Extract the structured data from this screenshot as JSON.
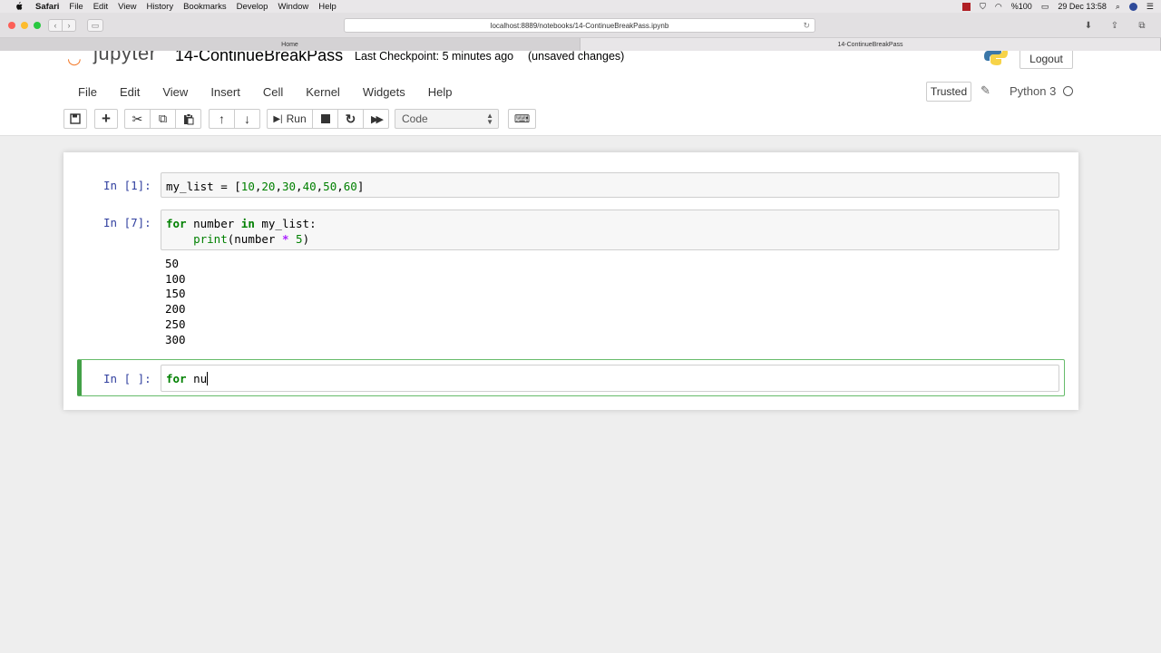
{
  "macos": {
    "app": "Safari",
    "menus": [
      "File",
      "Edit",
      "View",
      "History",
      "Bookmarks",
      "Develop",
      "Window",
      "Help"
    ],
    "battery": "%100",
    "clock": "29 Dec 13:58"
  },
  "browser": {
    "url": "localhost:8889/notebooks/14-ContinueBreakPass.ipynb",
    "tabs": [
      "Home",
      "14-ContinueBreakPass"
    ]
  },
  "jupyter": {
    "logo_text": "jupyter",
    "notebook_title": "14-ContinueBreakPass",
    "checkpoint": "Last Checkpoint: 5 minutes ago",
    "unsaved": "(unsaved changes)",
    "logout_label": "Logout",
    "menus": [
      "File",
      "Edit",
      "View",
      "Insert",
      "Cell",
      "Kernel",
      "Widgets",
      "Help"
    ],
    "trusted_label": "Trusted",
    "kernel_name": "Python 3",
    "toolbar": {
      "run_label": "Run",
      "cell_type": "Code"
    }
  },
  "cells": [
    {
      "prompt": "In [1]:",
      "code_parts": [
        "my_list = [",
        "10",
        ",",
        "20",
        ",",
        "30",
        ",",
        "40",
        ",",
        "50",
        ",",
        "60",
        "]"
      ]
    },
    {
      "prompt": "In [7]:",
      "line1": [
        "for",
        " number ",
        "in",
        " my_list:"
      ],
      "line2": [
        "    ",
        "print",
        "(number ",
        "*",
        " ",
        "5",
        ")"
      ],
      "outputs": [
        "50",
        "100",
        "150",
        "200",
        "250",
        "300"
      ]
    },
    {
      "prompt": "In [ ]:",
      "code_parts": [
        "for",
        " nu"
      ]
    }
  ],
  "colors": {
    "prompt": "#303f9f",
    "keyword": "#008000",
    "active_border": "#43a047"
  }
}
